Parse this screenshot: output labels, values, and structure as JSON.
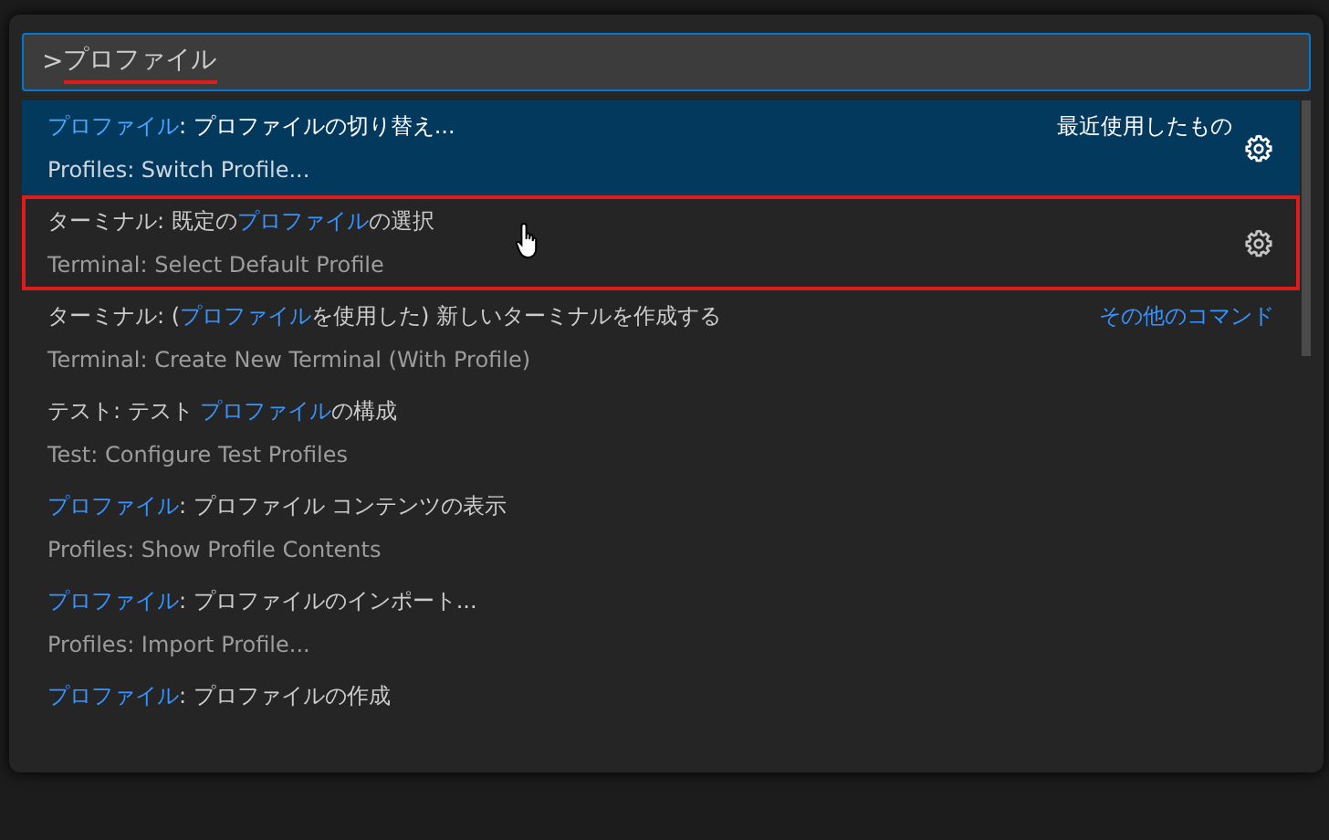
{
  "search": {
    "prefix": ">",
    "query": "プロファイル",
    "query_underlined": true
  },
  "commands": [
    {
      "label": [
        {
          "text": "プロファイル",
          "match": true
        },
        {
          "text": ": プロファイルの切り替え...",
          "match": false
        }
      ],
      "description": "Profiles: Switch Profile...",
      "selected": true,
      "outlined": false,
      "group_label": "最近使用したもの",
      "gear": true,
      "hovered": false
    },
    {
      "label": [
        {
          "text": "ターミナル: 既定の",
          "match": false
        },
        {
          "text": "プロファイル",
          "match": true
        },
        {
          "text": "の選択",
          "match": false
        }
      ],
      "description": "Terminal: Select Default Profile",
      "selected": false,
      "outlined": true,
      "gear": true,
      "hovered": true
    },
    {
      "label": [
        {
          "text": "ターミナル: (",
          "match": false
        },
        {
          "text": "プロファイル",
          "match": true
        },
        {
          "text": "を使用した) 新しいターミナルを作成する",
          "match": false
        }
      ],
      "description": "Terminal: Create New Terminal (With Profile)",
      "selected": false,
      "outlined": false,
      "group_label": "その他のコマンド",
      "gear": false,
      "hovered": false
    },
    {
      "label": [
        {
          "text": "テスト: テスト ",
          "match": false
        },
        {
          "text": "プロファイル",
          "match": true
        },
        {
          "text": "の構成",
          "match": false
        }
      ],
      "description": "Test: Configure Test Profiles",
      "selected": false,
      "outlined": false,
      "gear": false,
      "hovered": false
    },
    {
      "label": [
        {
          "text": "プロファイル",
          "match": true
        },
        {
          "text": ": プロファイル コンテンツの表示",
          "match": false
        }
      ],
      "description": "Profiles: Show Profile Contents",
      "selected": false,
      "outlined": false,
      "gear": false,
      "hovered": false
    },
    {
      "label": [
        {
          "text": "プロファイル",
          "match": true
        },
        {
          "text": ": プロファイルのインポート...",
          "match": false
        }
      ],
      "description": "Profiles: Import Profile...",
      "selected": false,
      "outlined": false,
      "gear": false,
      "hovered": false
    },
    {
      "label": [
        {
          "text": "プロファイル",
          "match": true
        },
        {
          "text": ": プロファイルの作成",
          "match": false
        }
      ],
      "selected": false,
      "outlined": false,
      "gear": false,
      "hovered": false
    }
  ]
}
